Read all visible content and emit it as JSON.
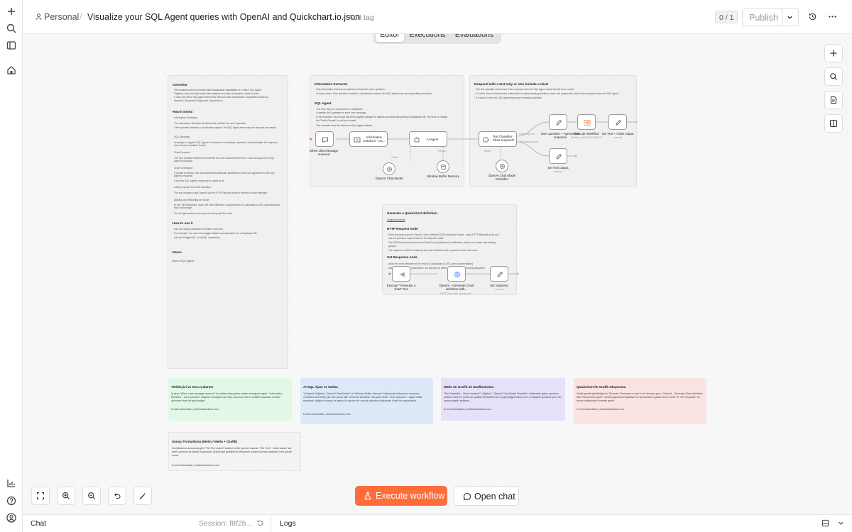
{
  "header": {
    "project": "Personal",
    "separator": "/",
    "workflow_title": "Visualize your SQL Agent queries with OpenAI and Quickchart.io.json",
    "add_tag": "+ Add tag",
    "version_badge": "0 / 1",
    "publish_label": "Publish"
  },
  "tabs": [
    "Editor",
    "Executions",
    "Evaluations"
  ],
  "sticky_overview": {
    "title": "Overview",
    "lines": [
      "This workflow aims to provide data visualization capabilities to a native SQL Agent.",
      "Together, they can help foster data analysis and data visualization within a team.",
      "It uses the native SQL Agent that works well and adds visualization capabilities thanks to",
      "OpenAI's Structured Output and Quickchart.io."
    ],
    "how_title": "How it works",
    "how_lines": [
      "Information Extraction:",
      "The Information Extractor identifies and extracts the user's question.",
      "If the question includes a visualization aspect, the SQL Agent alone may not respond accurately.",
      "SQL Querying:",
      "Leveraged a regular SQL Agent: it connects to a database, queries it, and translates the response into a human-readable format.",
      "Chart Decision:",
      "The Text Classifier determines whether the user would benefit from a chart to support the SQL Agent's response.",
      "Chart Generation:",
      "If a chart is needed, the sub-workflow dynamically generates a chart and appends it to the SQL Agent's response.",
      "If not, the SQL Agent's response is output as is.",
      "Calling OpenAI for Chart Definition:",
      "The sub-workflow calls OpenAI via the HTTP Request node to retrieve a chart definition.",
      "Building and Returning the Chart:",
      "In the \"Set Response\" node, the chart definition is appended to a Quickchart.io URL, generating the final chart image.",
      "The AI Agent returns the response along with the chart."
    ],
    "use_title": "How to use it",
    "use_lines": [
      "Use an existing database or create a new one.",
      "For example, I've used this Kaggle dataset and uploaded it to a Supabase DB.",
      "Add the PostgreSQL or MySQL credentials."
    ],
    "demo_title": "Demo",
    "demo_image_alt": "Demo SQL Agent"
  },
  "sticky_info": {
    "title": "Information Extractor",
    "lines": [
      "This Information Extractor is added to extract the user's question.",
      "In some cases, if the question contains a visualization aspect, the SQL Agent may not responding accurately."
    ],
    "sql_title": "SQL Agent",
    "sql_lines": [
      "This SQL Agent is connected to a Database.",
      "It queries the Database for each user message.",
      "In this example, the prompt has been slightly changed to address an issue with getting a Supabase DB. Feel free to change",
      "the \"Prefix Prompt\" to suit your needs.",
      "This example uses the data from this Kaggle dataset."
    ]
  },
  "sticky_respond": {
    "title": "Respond with a text only or also include a chart",
    "lines": [
      "The text classifier determines if the response from the SQL Agent would benefit from a chart.",
      "If it does, then it executes the subworkflow to dynamically generate a chart, and append the chart to the response from the SQL Agent.",
      "If it doesn't, then the SQL Agent response is directly outputted."
    ]
  },
  "sticky_generate": {
    "title": "Generate a Quickchart definition",
    "link": "Original template",
    "http_title": "HTTP Request node",
    "http_lines": [
      "Send the chart query to OpenAI, with a defined JSON response format - using HTTP Request node as it",
      "has not yet been implemented in the OpenAI nodes.",
      "The JSON structure is based on ChartJS and Quickchart.io definitions, that let us create nice-looking",
      "graphs.",
      "The output is a JSON containing the chart definition that is passed to the next node."
    ],
    "set_title": "Set Response node",
    "set_lines": [
      "Adds the chart definition at the end of a Quickchart.io URL (see documentation)",
      "Note that, in the URL parameters, we specify the width and height to be properly displayed"
    ]
  },
  "nodes": {
    "chat_trigger": "When chat message received",
    "info_extractor": "Information Extractor - Us...",
    "ai_agent": "AI Agent",
    "openai_model_1": "OpenAI Chat Model",
    "window_memory": "Window Buffer Memory",
    "text_classifier": "Text Classifier - Chart required?",
    "openai_model_2": "OpenAI Chat Model Classifier",
    "user_question": "User question + Agent initial response",
    "execute_workflow": "Execute Workflow",
    "set_text_chart": "Set Text + Chart output",
    "set_text": "Set Text output",
    "exec_trigger": "Execute \"Generate a chart\" tool",
    "openai_generate": "OpenAI - Generate Chart definition with...",
    "set_response": "Set response",
    "sub_manual": "manual",
    "sub_post": "POST: https://api.openai.com...",
    "sub_exec": "Workflow: 1234NESLNBpIDH",
    "port_model": "Model",
    "port_memory": "Memory",
    "port_chart": "Chart required",
    "port_no_chart": "No chart required",
    "port_model2": "Model*"
  },
  "colored_notes": [
    {
      "title": "Tetikleyici ve Soru Çıkarımı",
      "body": "İş akışı \"When chat message received\" ile kullanıcıdan gelen sohbet mesajıyla başlar. \"Information Extractor - User question\" düğümü mesajdan asıl SQL sorusunu net bir şekilde çıkararak sonraki adımlara temiz bir girdi sağlar.",
      "footer": "D-mim Automation | dmimautomation.com",
      "color": "#e3f7e6"
    },
    {
      "title": "AI SQL Ajanı ve Hafıza",
      "body": "\"AI Agent\" düğümü, \"OpenAI Chat Model\" ve \"Window Buffer Memory\" kullanarak kullanıcının sorusunu veritabanı üzerinden (bir alt iş akışı olan \"Execute Workflow\" ile) yanıt üretir. \"User question + Agent initial response\" düğümü soruyu ve ajanın ilk yanıtını bir sonraki adımda kullanılmak üzere bir araya getirir.",
      "footer": "D-mim Automation | dmimautomation.com",
      "color": "#dde9f8"
    },
    {
      "title": "Metin mi Grafik mi Sınıflandırma",
      "body": "\"Text Classifier - Chart required?\" düğümü, \"OpenAI Chat Model Classifier\" kullanarak ajanın yanıtının sadece metin mi yoksa bir grafikle desteklenmesi mi gerektiğine karar verir; bu sayede gereksiz yere her zaman grafik üretilmez.",
      "footer": "D-mim Automation | dmimautomation.com",
      "color": "#e6e0f8"
    },
    {
      "title": "Quickchart ile Grafik Oluşturma",
      "body": "Grafik gerekli görüldüğünde \"Execute 'Generate a chart' tool\" devreye girer; \"OpenAI - Generate Chart definition with Structured Output\" verilebi yapısal sonuçlardan bir Quickchart.io grafik tanımı üretir ve \"Set response\" bu tanımı kullanılabilir formata getirir.",
      "footer": "D-mim Automation | dmimautomation.com",
      "color": "#fbe3e3"
    },
    {
      "title": "Sonuç Formatlama (Metin / Metin + Grafik)",
      "body": "Sınıflandırma sonucuna göre \"Set Text output\" sadece metin yanıtını hazırlar, \"Set Text + Chart output\" ise metin yanıtına ek olarak oluşturulan Quickchart grafiğini de ekleyerek kullanıcıya tam açıklama hem görsel sunar.",
      "footer": "D-mim Automation | dmimautomation.com",
      "color": "#f3f3f3"
    }
  ],
  "buttons": {
    "execute": "Execute workflow",
    "open_chat": "Open chat"
  },
  "bottom": {
    "chat": "Chat",
    "session": "Session: f8f2b...",
    "logs": "Logs"
  },
  "colors": {
    "accent": "#ff6d3a",
    "link_purple": "#7b61ff"
  }
}
